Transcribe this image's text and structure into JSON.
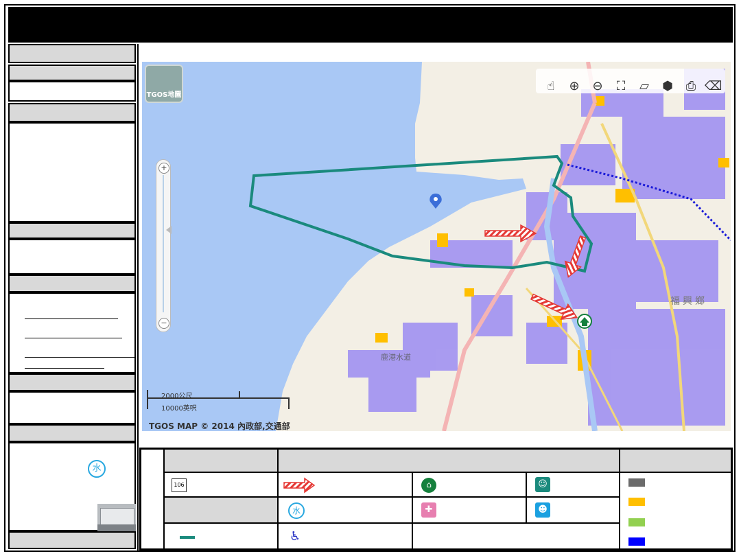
{
  "map": {
    "tgos_button_label": "TGOS地圖",
    "scale_metric": "2000公尺",
    "scale_imperial": "10000英呎",
    "copyright": "TGOS MAP © 2014 內政部,交通部",
    "place_label_1": "福興鄉",
    "place_label_2": "鹿港水道",
    "tools": [
      "pan-icon",
      "zoom-in-icon",
      "zoom-out-icon",
      "full-extent-icon",
      "measure-line-icon",
      "measure-area-icon",
      "print-icon",
      "eraser-icon"
    ]
  },
  "legend": {
    "route_sign": "106",
    "water_glyph": "水",
    "wheelchair_glyph": "♿",
    "colors": {
      "gray": "#6b6b6b",
      "orange": "#ffbf00",
      "green": "#92d050",
      "blue": "#0000ff",
      "teal": "#1a8a7d",
      "purple": "#9b8cf2",
      "sea": "#a9c8f5"
    }
  },
  "sidebar": {
    "water_glyph": "水"
  }
}
